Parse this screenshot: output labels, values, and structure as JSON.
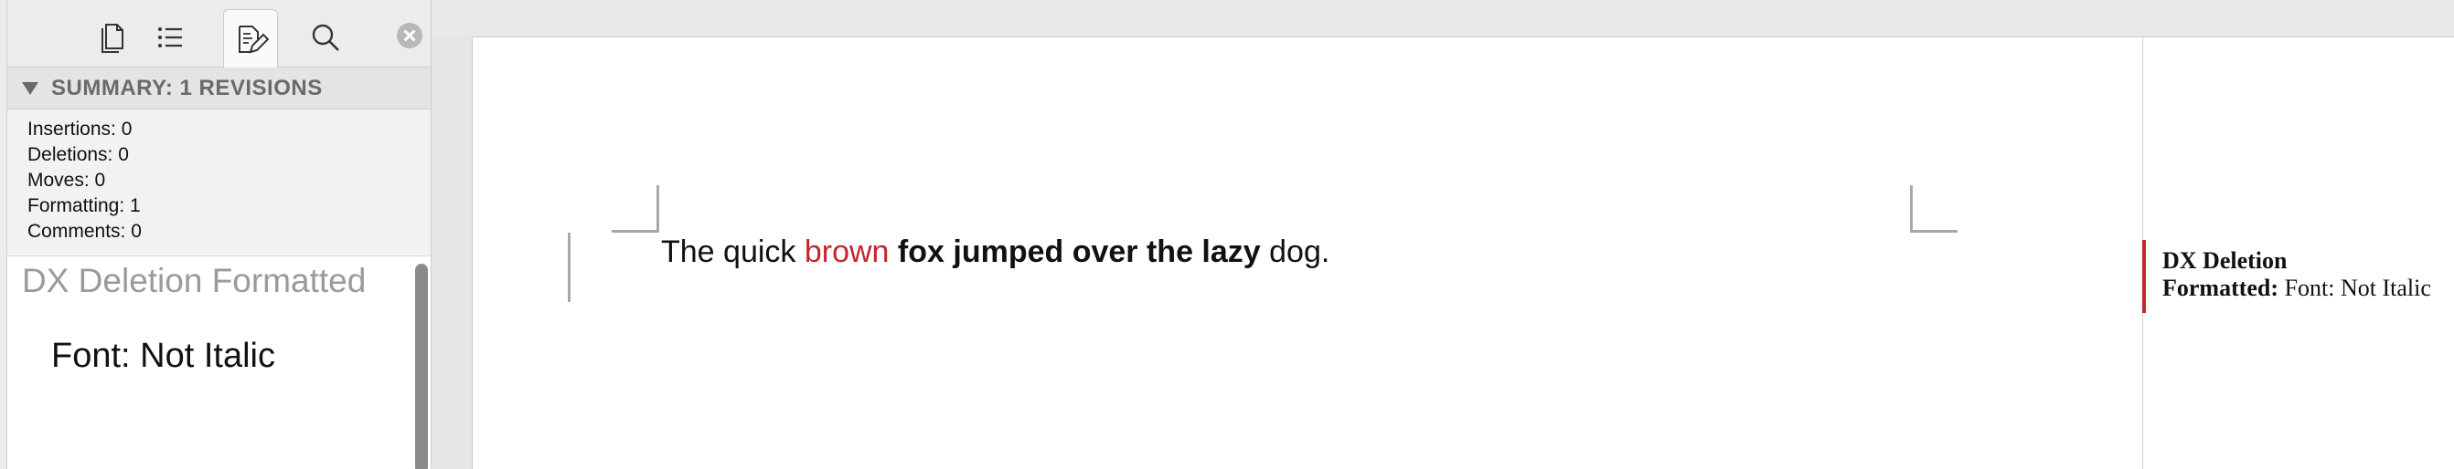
{
  "sidebar": {
    "toolbar": {
      "buttons": [
        {
          "icon": "pages-icon"
        },
        {
          "icon": "list-icon"
        },
        {
          "icon": "revisions-icon",
          "active": true
        },
        {
          "icon": "search-icon"
        }
      ],
      "close_icon": "close-circle-icon"
    },
    "summary": {
      "header": "SUMMARY: 1 REVISIONS",
      "rows": [
        "Insertions: 0",
        "Deletions: 0",
        "Moves: 0",
        "Formatting: 1",
        "Comments: 0"
      ]
    },
    "detail": {
      "title": "DX Deletion Formatted",
      "value": "Font: Not Italic"
    }
  },
  "document": {
    "line": {
      "plain1": "The quick ",
      "brown": "brown",
      "space": " ",
      "bold": "fox jumped over the lazy",
      "plain2": " dog."
    },
    "comment": {
      "title": "DX Deletion",
      "label": "Formatted:",
      "body": " Font: Not Italic"
    }
  },
  "colors": {
    "revision_red": "#c4262b",
    "detail_title_gray": "#9a9a9a"
  }
}
